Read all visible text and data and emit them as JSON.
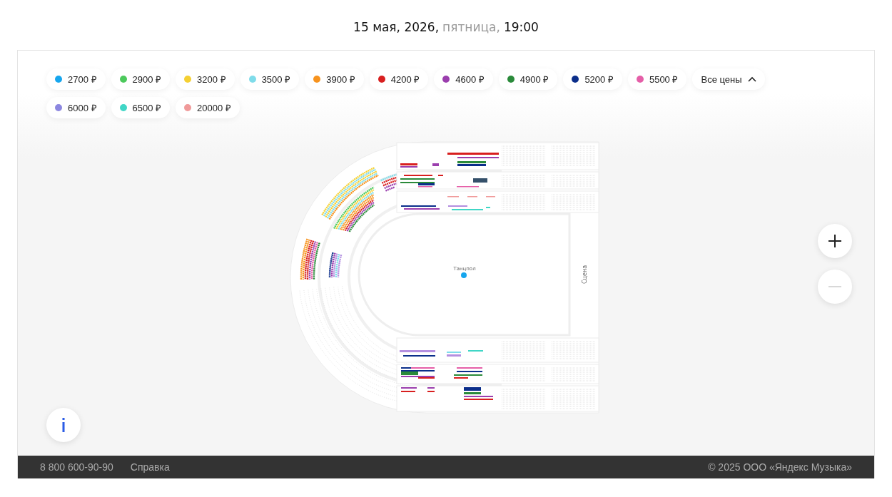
{
  "header": {
    "date": "15 мая, 2026,",
    "weekday": "пятница,",
    "time": "19:00"
  },
  "price_filters": [
    {
      "label": "2700 ₽",
      "color": "#16a6ee"
    },
    {
      "label": "2900 ₽",
      "color": "#4cc95c"
    },
    {
      "label": "3200 ₽",
      "color": "#f5d033"
    },
    {
      "label": "3500 ₽",
      "color": "#7fdcea"
    },
    {
      "label": "3900 ₽",
      "color": "#f7931e"
    },
    {
      "label": "4200 ₽",
      "color": "#d81f1f"
    },
    {
      "label": "4600 ₽",
      "color": "#9b3fae"
    },
    {
      "label": "4900 ₽",
      "color": "#2a8a3a"
    },
    {
      "label": "5200 ₽",
      "color": "#0b2e8a"
    },
    {
      "label": "5500 ₽",
      "color": "#e55fa8"
    },
    {
      "label": "6000 ₽",
      "color": "#8c87e0"
    },
    {
      "label": "6500 ₽",
      "color": "#40d6c6"
    },
    {
      "label": "20000 ₽",
      "color": "#f09a9a"
    }
  ],
  "all_prices": {
    "label": "Все цены",
    "expanded": true
  },
  "seat_map": {
    "dance_floor": "Танцпол",
    "stage": "Сцена"
  },
  "zoom_in": {
    "disabled": false
  },
  "zoom_out": {
    "disabled": true
  },
  "footer": {
    "phone": "8 800 600-90-90",
    "help": "Справка",
    "copyright": "© 2025 ООО «Яндекс Музыка»"
  }
}
